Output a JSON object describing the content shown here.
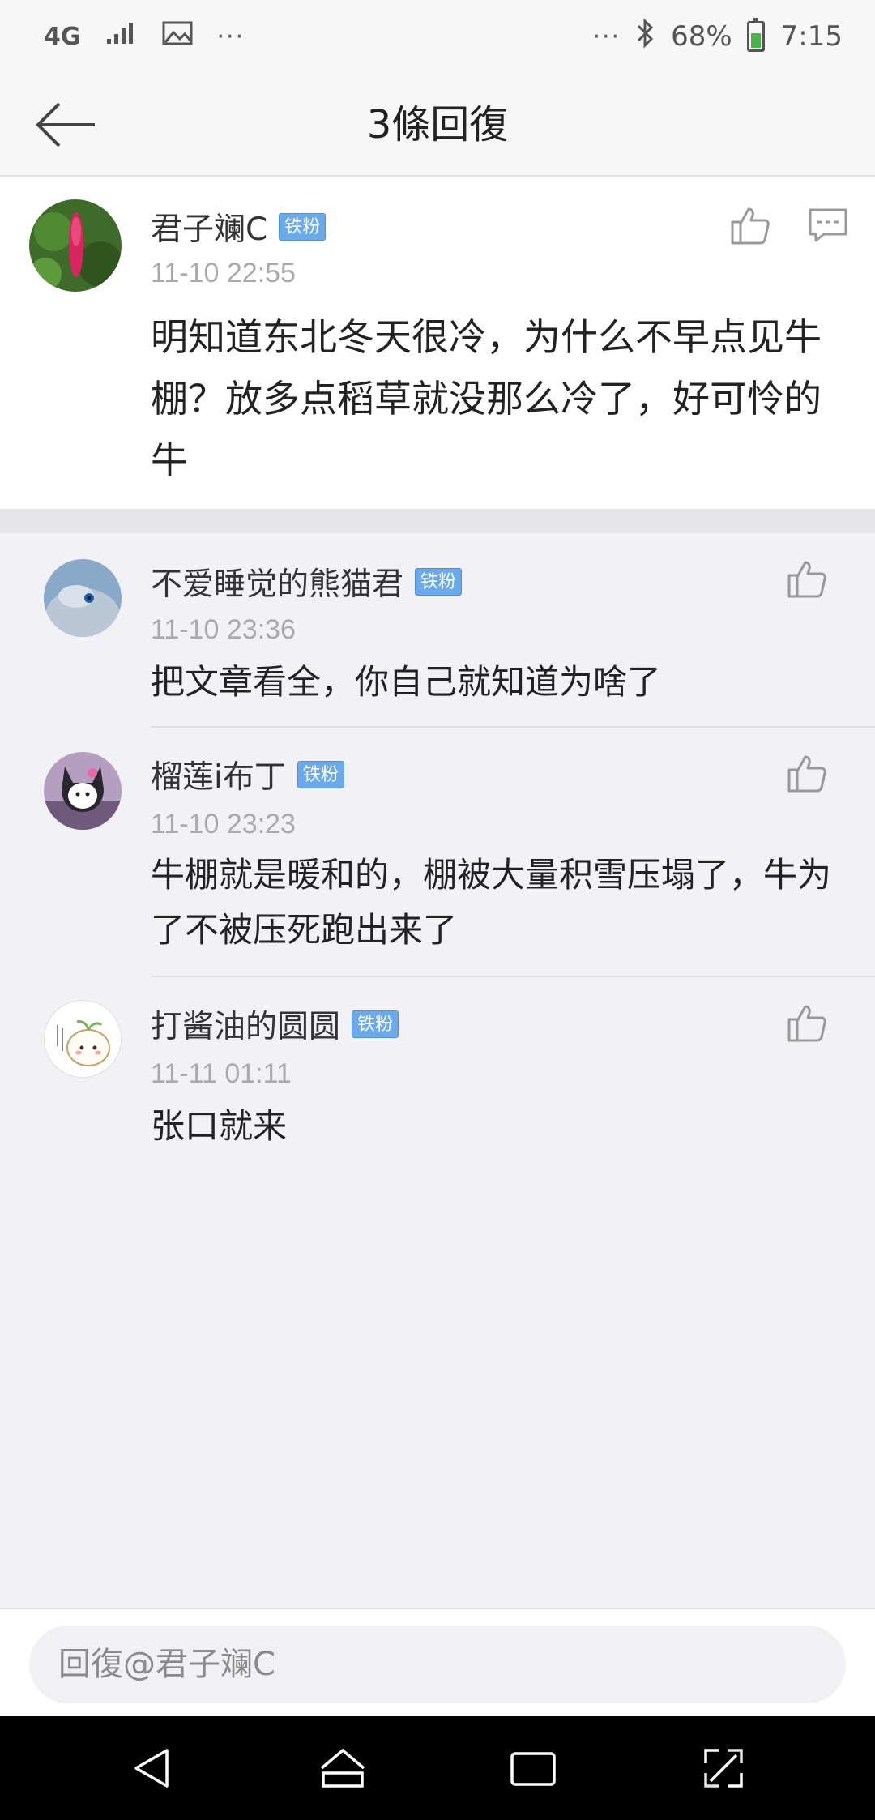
{
  "status_bar": {
    "network": "4G",
    "dots_left": "···",
    "dots_right": "···",
    "battery": "68%",
    "time": "7:15",
    "battery_color": "#49b34a"
  },
  "header": {
    "title": "3條回復",
    "back_icon": "arrow-left-icon"
  },
  "main_comment": {
    "username": "君子斓C",
    "badge": "铁粉",
    "time": "11-10 22:55",
    "text": "明知道东北冬天很冷，为什么不早点见牛棚？放多点稻草就没那么冷了，好可怜的牛"
  },
  "replies": [
    {
      "username": "不爱睡觉的熊猫君",
      "badge": "铁粉",
      "time": "11-10 23:36",
      "text": "把文章看全，你自己就知道为啥了"
    },
    {
      "username": "榴莲i布丁",
      "badge": "铁粉",
      "time": "11-10 23:23",
      "text": "牛棚就是暖和的，棚被大量积雪压塌了，牛为了不被压死跑出来了"
    },
    {
      "username": "打酱油的圆圆",
      "badge": "铁粉",
      "time": "11-11 01:11",
      "text": "张口就来"
    }
  ],
  "reply_input": {
    "placeholder": "回復@君子斓C"
  },
  "colors": {
    "badge": "#6aa9ea",
    "background": "#f1f1f6",
    "nav_bar": "#000000"
  }
}
